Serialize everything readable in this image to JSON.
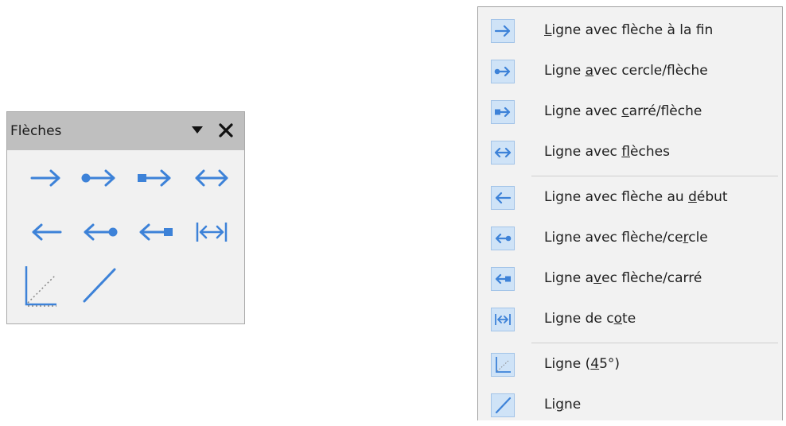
{
  "colors": {
    "icon_blue": "#3d82d8",
    "icon_bg": "#cfe3f7",
    "menu_bg": "#f2f2f2",
    "titlebar_bg": "#bfbfbf"
  },
  "toolbar": {
    "title": "Flèches",
    "dropdown_icon": "triangle-down-icon",
    "close_icon": "close-icon",
    "buttons": [
      {
        "icon": "arrow-end-icon"
      },
      {
        "icon": "circle-arrow-icon"
      },
      {
        "icon": "square-arrow-icon"
      },
      {
        "icon": "double-arrow-icon"
      },
      {
        "icon": "arrow-start-icon"
      },
      {
        "icon": "arrow-circle-icon"
      },
      {
        "icon": "arrow-square-icon"
      },
      {
        "icon": "dimension-line-icon"
      },
      {
        "icon": "line-45-icon"
      },
      {
        "icon": "line-icon"
      }
    ]
  },
  "menu": {
    "items": [
      {
        "pre": "",
        "u": "L",
        "post": "igne avec flèche à la fin",
        "icon": "arrow-end-icon"
      },
      {
        "pre": "Ligne ",
        "u": "a",
        "post": "vec cercle/flèche",
        "icon": "circle-arrow-icon"
      },
      {
        "pre": "Ligne avec ",
        "u": "c",
        "post": "arré/flèche",
        "icon": "square-arrow-icon"
      },
      {
        "pre": "Ligne avec ",
        "u": "f",
        "post": "lèches",
        "icon": "double-arrow-icon"
      },
      {
        "pre": "Ligne avec flèche au ",
        "u": "d",
        "post": "ébut",
        "icon": "arrow-start-icon"
      },
      {
        "pre": "Ligne avec flèche/ce",
        "u": "r",
        "post": "cle",
        "icon": "arrow-circle-icon"
      },
      {
        "pre": "Ligne a",
        "u": "v",
        "post": "ec flèche/carré",
        "icon": "arrow-square-icon"
      },
      {
        "pre": "Ligne de c",
        "u": "o",
        "post": "te",
        "icon": "dimension-line-icon"
      },
      {
        "pre": "Ligne (",
        "u": "4",
        "post": "5°)",
        "icon": "line-45-icon"
      },
      {
        "pre": "Li",
        "u": "g",
        "post": "ne",
        "icon": "line-icon"
      }
    ]
  }
}
